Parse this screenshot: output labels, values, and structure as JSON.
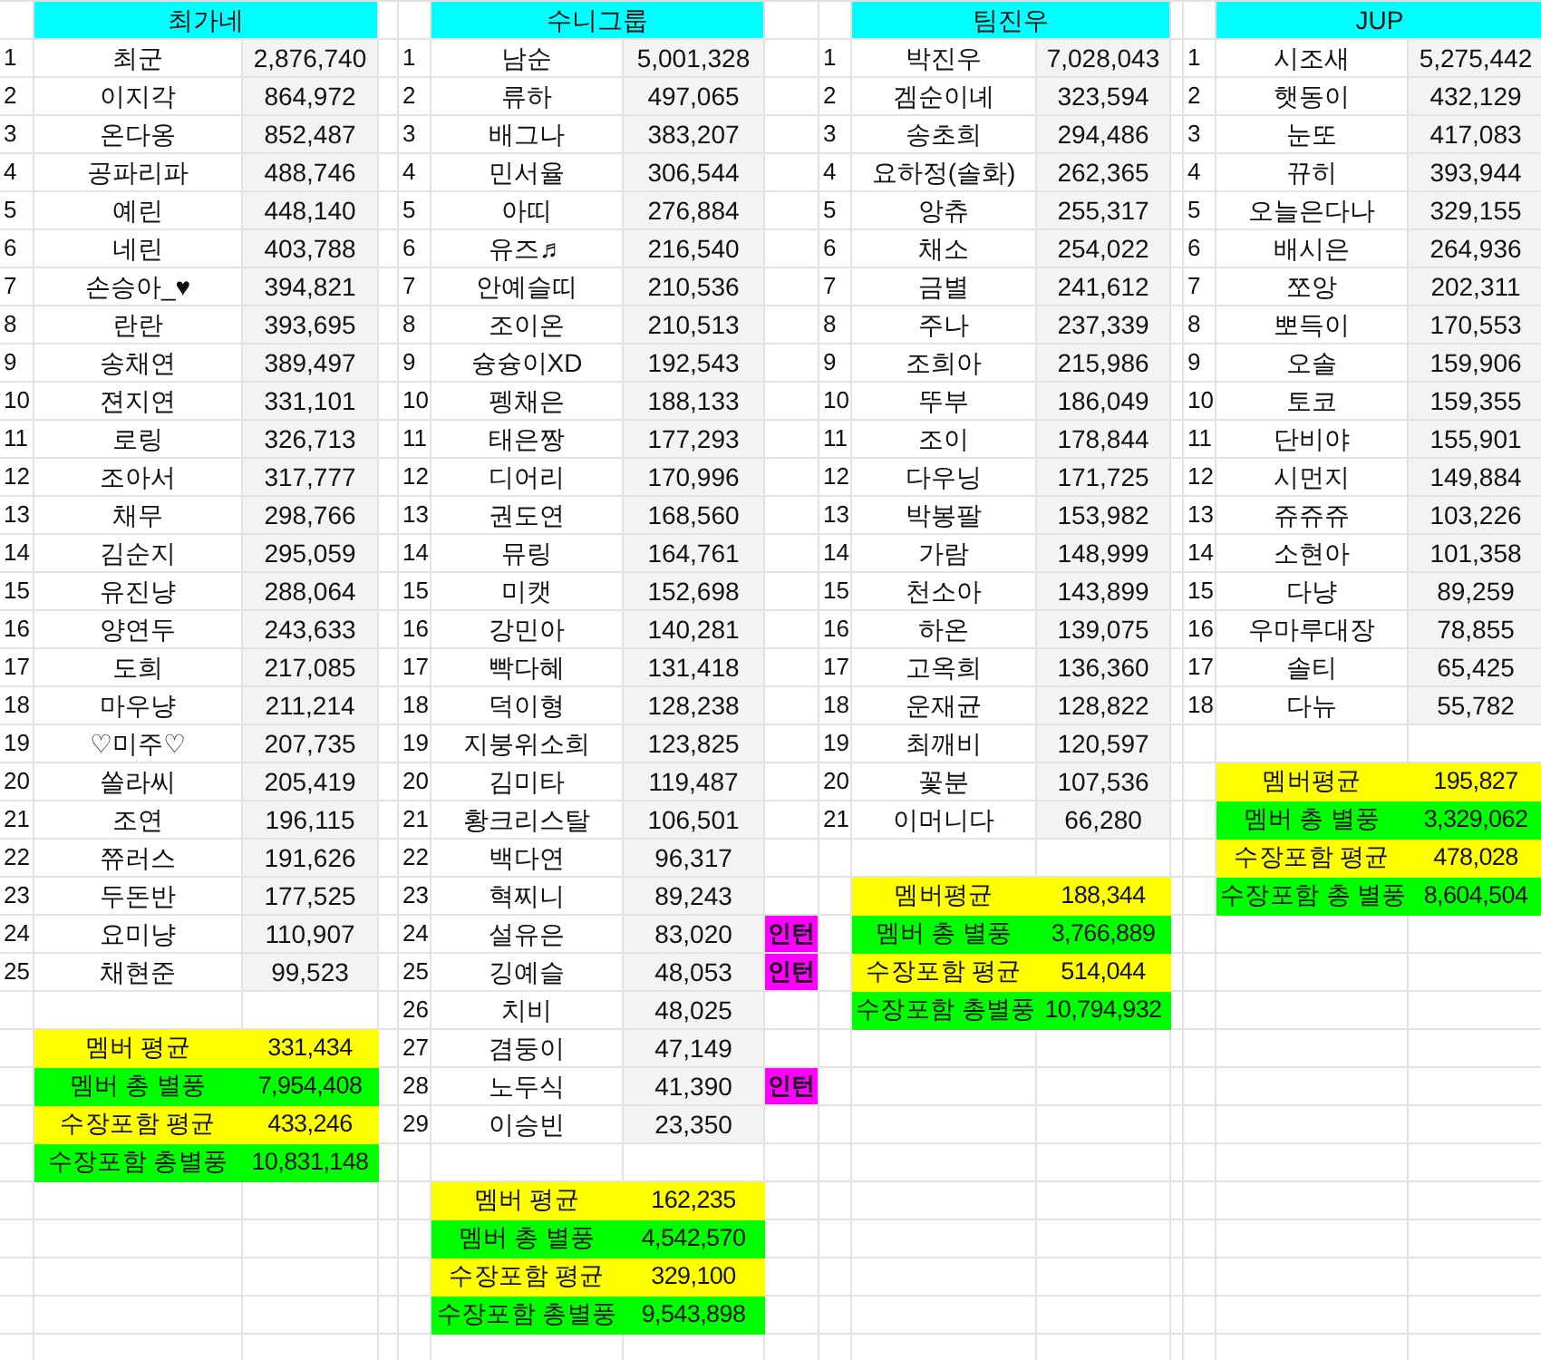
{
  "groups": [
    {
      "title": "최가네",
      "members": [
        {
          "rank": "1",
          "name": "최군",
          "value": "2,876,740"
        },
        {
          "rank": "2",
          "name": "이지각",
          "value": "864,972"
        },
        {
          "rank": "3",
          "name": "온다옹",
          "value": "852,487"
        },
        {
          "rank": "4",
          "name": "공파리파",
          "value": "488,746"
        },
        {
          "rank": "5",
          "name": "예린",
          "value": "448,140"
        },
        {
          "rank": "6",
          "name": "네린",
          "value": "403,788"
        },
        {
          "rank": "7",
          "name": "손승아_♥",
          "value": "394,821"
        },
        {
          "rank": "8",
          "name": "란란",
          "value": "393,695"
        },
        {
          "rank": "9",
          "name": "송채연",
          "value": "389,497"
        },
        {
          "rank": "10",
          "name": "젼지연",
          "value": "331,101"
        },
        {
          "rank": "11",
          "name": "로링",
          "value": "326,713"
        },
        {
          "rank": "12",
          "name": "조아서",
          "value": "317,777"
        },
        {
          "rank": "13",
          "name": "채무",
          "value": "298,766"
        },
        {
          "rank": "14",
          "name": "김순지",
          "value": "295,059"
        },
        {
          "rank": "15",
          "name": "유진냥",
          "value": "288,064"
        },
        {
          "rank": "16",
          "name": "양연두",
          "value": "243,633"
        },
        {
          "rank": "17",
          "name": "도희",
          "value": "217,085"
        },
        {
          "rank": "18",
          "name": "마우냥",
          "value": "211,214"
        },
        {
          "rank": "19",
          "name": "♡미주♡",
          "value": "207,735"
        },
        {
          "rank": "20",
          "name": "쏠라씨",
          "value": "205,419"
        },
        {
          "rank": "21",
          "name": "조연",
          "value": "196,115"
        },
        {
          "rank": "22",
          "name": "쮸러스",
          "value": "191,626"
        },
        {
          "rank": "23",
          "name": "두돈반",
          "value": "177,525"
        },
        {
          "rank": "24",
          "name": "요미냥",
          "value": "110,907"
        },
        {
          "rank": "25",
          "name": "채현준",
          "value": "99,523"
        }
      ],
      "summary": [
        {
          "label": "멤버 평균",
          "value": "331,434",
          "color": "#ffff00"
        },
        {
          "label": "멤버 총 별풍",
          "value": "7,954,408",
          "color": "#00ff00"
        },
        {
          "label": "수장포함 평균",
          "value": "433,246",
          "color": "#ffff00"
        },
        {
          "label": "수장포함 총별풍",
          "value": "10,831,148",
          "color": "#00ff00"
        }
      ]
    },
    {
      "title": "수니그룹",
      "members": [
        {
          "rank": "1",
          "name": "남순",
          "value": "5,001,328"
        },
        {
          "rank": "2",
          "name": "류하",
          "value": "497,065"
        },
        {
          "rank": "3",
          "name": "배그나",
          "value": "383,207"
        },
        {
          "rank": "4",
          "name": "민서율",
          "value": "306,544"
        },
        {
          "rank": "5",
          "name": "아띠",
          "value": "276,884"
        },
        {
          "rank": "6",
          "name": "유즈♬",
          "value": "216,540"
        },
        {
          "rank": "7",
          "name": "안예슬띠",
          "value": "210,536"
        },
        {
          "rank": "8",
          "name": "조이온",
          "value": "210,513"
        },
        {
          "rank": "9",
          "name": "슝슝이XD",
          "value": "192,543"
        },
        {
          "rank": "10",
          "name": "펭채은",
          "value": "188,133"
        },
        {
          "rank": "11",
          "name": "태은짱",
          "value": "177,293"
        },
        {
          "rank": "12",
          "name": "디어리",
          "value": "170,996"
        },
        {
          "rank": "13",
          "name": "권도연",
          "value": "168,560"
        },
        {
          "rank": "14",
          "name": "뮤링",
          "value": "164,761"
        },
        {
          "rank": "15",
          "name": "미캣",
          "value": "152,698"
        },
        {
          "rank": "16",
          "name": "강민아",
          "value": "140,281"
        },
        {
          "rank": "17",
          "name": "빡다혜",
          "value": "131,418"
        },
        {
          "rank": "18",
          "name": "덕이형",
          "value": "128,238"
        },
        {
          "rank": "19",
          "name": "지붕위소희",
          "value": "123,825"
        },
        {
          "rank": "20",
          "name": "김미타",
          "value": "119,487"
        },
        {
          "rank": "21",
          "name": "황크리스탈",
          "value": "106,501"
        },
        {
          "rank": "22",
          "name": "백다연",
          "value": "96,317"
        },
        {
          "rank": "23",
          "name": "혁찌니",
          "value": "89,243"
        },
        {
          "rank": "24",
          "name": "설유은",
          "value": "83,020",
          "tag": "인턴"
        },
        {
          "rank": "25",
          "name": "깅예슬",
          "value": "48,053",
          "tag": "인턴"
        },
        {
          "rank": "26",
          "name": "치비",
          "value": "48,025"
        },
        {
          "rank": "27",
          "name": "겸둥이",
          "value": "47,149"
        },
        {
          "rank": "28",
          "name": "노두식",
          "value": "41,390",
          "tag": "인턴"
        },
        {
          "rank": "29",
          "name": "이승빈",
          "value": "23,350"
        }
      ],
      "summary": [
        {
          "label": "멤버 평균",
          "value": "162,235",
          "color": "#ffff00"
        },
        {
          "label": "멤버 총 별풍",
          "value": "4,542,570",
          "color": "#00ff00"
        },
        {
          "label": "수장포함 평균",
          "value": "329,100",
          "color": "#ffff00"
        },
        {
          "label": "수장포함 총별풍",
          "value": "9,543,898",
          "color": "#00ff00"
        }
      ]
    },
    {
      "title": "팀진우",
      "members": [
        {
          "rank": "1",
          "name": "박진우",
          "value": "7,028,043"
        },
        {
          "rank": "2",
          "name": "겜순이녜",
          "value": "323,594"
        },
        {
          "rank": "3",
          "name": "송초희",
          "value": "294,486"
        },
        {
          "rank": "4",
          "name": "요하정(솔화)",
          "value": "262,365"
        },
        {
          "rank": "5",
          "name": "앙츄",
          "value": "255,317"
        },
        {
          "rank": "6",
          "name": "채소",
          "value": "254,022"
        },
        {
          "rank": "7",
          "name": "금별",
          "value": "241,612"
        },
        {
          "rank": "8",
          "name": "주나",
          "value": "237,339"
        },
        {
          "rank": "9",
          "name": "조희아",
          "value": "215,986"
        },
        {
          "rank": "10",
          "name": "뚜부",
          "value": "186,049"
        },
        {
          "rank": "11",
          "name": "조이",
          "value": "178,844"
        },
        {
          "rank": "12",
          "name": "다우닝",
          "value": "171,725"
        },
        {
          "rank": "13",
          "name": "박봉팔",
          "value": "153,982"
        },
        {
          "rank": "14",
          "name": "가람",
          "value": "148,999"
        },
        {
          "rank": "15",
          "name": "천소아",
          "value": "143,899"
        },
        {
          "rank": "16",
          "name": "하온",
          "value": "139,075"
        },
        {
          "rank": "17",
          "name": "고옥희",
          "value": "136,360"
        },
        {
          "rank": "18",
          "name": "운재균",
          "value": "128,822"
        },
        {
          "rank": "19",
          "name": "최깨비",
          "value": "120,597"
        },
        {
          "rank": "20",
          "name": "꽃분",
          "value": "107,536"
        },
        {
          "rank": "21",
          "name": "이머니다",
          "value": "66,280"
        }
      ],
      "summary": [
        {
          "label": "멤버평균",
          "value": "188,344",
          "color": "#ffff00"
        },
        {
          "label": "멤버 총 별풍",
          "value": "3,766,889",
          "color": "#00ff00"
        },
        {
          "label": "수장포함 평균",
          "value": "514,044",
          "color": "#ffff00"
        },
        {
          "label": "수장포함 총별풍",
          "value": "10,794,932",
          "color": "#00ff00"
        }
      ]
    },
    {
      "title": "JUP",
      "members": [
        {
          "rank": "1",
          "name": "시조새",
          "value": "5,275,442"
        },
        {
          "rank": "2",
          "name": "햇동이",
          "value": "432,129"
        },
        {
          "rank": "3",
          "name": "눈또",
          "value": "417,083"
        },
        {
          "rank": "4",
          "name": "뀨히",
          "value": "393,944"
        },
        {
          "rank": "5",
          "name": "오늘은다나",
          "value": "329,155"
        },
        {
          "rank": "6",
          "name": "배시은",
          "value": "264,936"
        },
        {
          "rank": "7",
          "name": "쪼앙",
          "value": "202,311"
        },
        {
          "rank": "8",
          "name": "뽀득이",
          "value": "170,553"
        },
        {
          "rank": "9",
          "name": "오솔",
          "value": "159,906"
        },
        {
          "rank": "10",
          "name": "토코",
          "value": "159,355"
        },
        {
          "rank": "11",
          "name": "단비야",
          "value": "155,901"
        },
        {
          "rank": "12",
          "name": "시먼지",
          "value": "149,884"
        },
        {
          "rank": "13",
          "name": "쥬쥬쥬",
          "value": "103,226"
        },
        {
          "rank": "14",
          "name": "소현아",
          "value": "101,358"
        },
        {
          "rank": "15",
          "name": "다냥",
          "value": "89,259"
        },
        {
          "rank": "16",
          "name": "우마루대장",
          "value": "78,855"
        },
        {
          "rank": "17",
          "name": "솔티",
          "value": "65,425"
        },
        {
          "rank": "18",
          "name": "다뉴",
          "value": "55,782"
        }
      ],
      "summary": [
        {
          "label": "멤버평균",
          "value": "195,827",
          "color": "#ffff00"
        },
        {
          "label": "멤버 총 별풍",
          "value": "3,329,062",
          "color": "#00ff00"
        },
        {
          "label": "수장포함 평균",
          "value": "478,028",
          "color": "#ffff00"
        },
        {
          "label": "수장포함 총 별풍",
          "value": "8,604,504",
          "color": "#00ff00"
        }
      ]
    }
  ]
}
